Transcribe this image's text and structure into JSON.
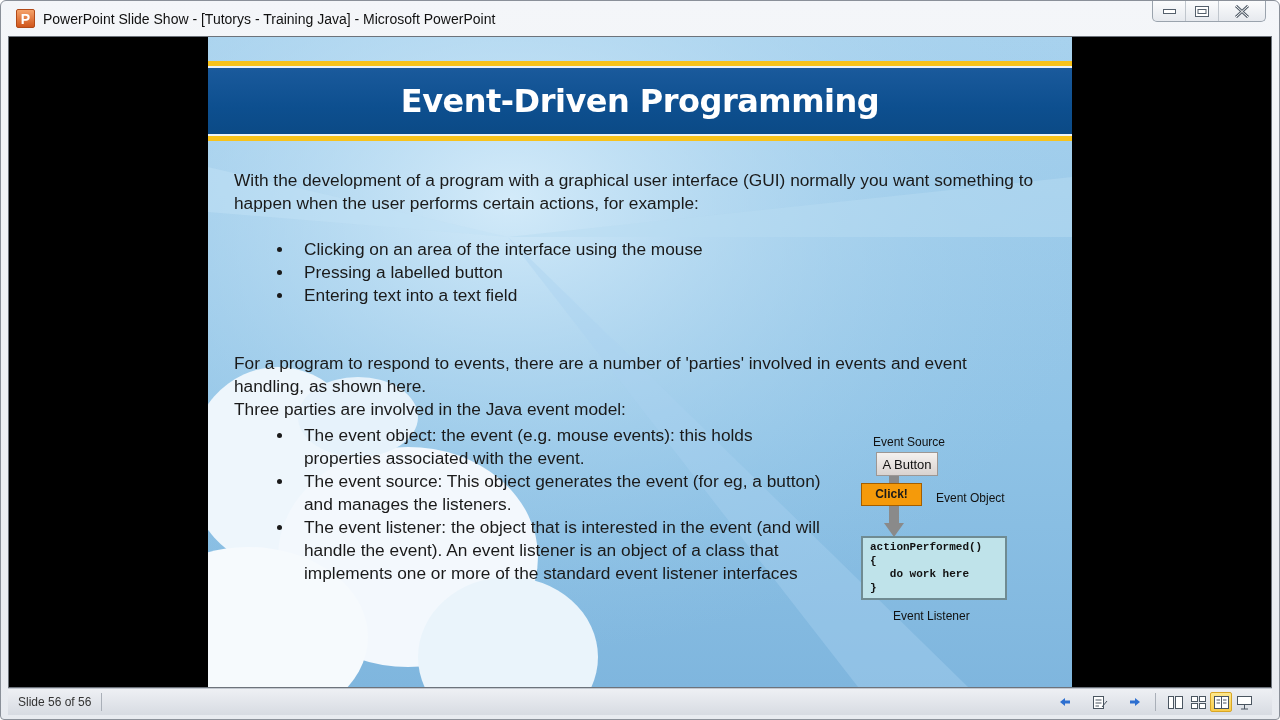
{
  "window": {
    "app_icon_letter": "P",
    "title": "PowerPoint Slide Show - [Tutorys - Training Java] - Microsoft PowerPoint"
  },
  "slide": {
    "title": "Event-Driven Programming",
    "intro": "With the development of a program with a graphical user interface (GUI) normally you want something to happen when the user performs certain actions, for example:",
    "bullets": [
      "Clicking on an area of the interface using the mouse",
      "Pressing a labelled button",
      "Entering text into a text field"
    ],
    "paragraphs": [
      "For a program to respond to events, there are a number of 'parties' involved in events and event handling, as shown here.",
      "Three parties are involved in the Java event model:"
    ],
    "parties": [
      "The event object: the event (e.g. mouse events): this holds properties associated with the event.",
      "The event source: This object generates the event (for eg, a button) and manages the listeners.",
      "The event listener: the object that is interested in the event (and will handle the event). An event listener is an object of a class that implements one or more of the standard event listener interfaces"
    ],
    "diagram": {
      "source_label": "Event Source",
      "button_label": "A Button",
      "event_button": "Click!",
      "object_label": "Event Object",
      "code_lines": [
        "actionPerformed()",
        "{",
        "   do work here",
        "}"
      ],
      "listener_label": "Event Listener"
    }
  },
  "status_bar": {
    "slide_counter": "Slide 56 of 56",
    "views": [
      {
        "kind": "normal",
        "selected": false
      },
      {
        "kind": "sorter",
        "selected": false
      },
      {
        "kind": "reading",
        "selected": true
      },
      {
        "kind": "show",
        "selected": false
      }
    ]
  }
}
